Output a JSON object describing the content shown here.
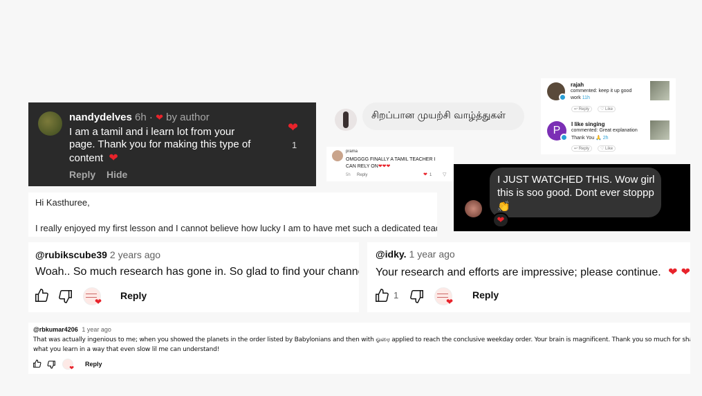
{
  "c1": {
    "username": "nandydelves",
    "time": "6h",
    "by_author": "by author",
    "text_line1": "I am a tamil and i learn lot from your",
    "text_line2": "page. Thank you  for making this type of",
    "text_line3": "content",
    "reply": "Reply",
    "hide": "Hide",
    "like_count": "1"
  },
  "c2": {
    "text": "சிறப்பான முயற்சி வாழ்த்துகள்"
  },
  "c3": {
    "username": "prama",
    "text_line1": "OMGGGG FINALLY A TAMIL TEACHER I",
    "text_line2": "CAN RELY ON",
    "time": "5h",
    "reply": "Reply",
    "like_count": "1"
  },
  "c4": {
    "items": [
      {
        "name": "rajah",
        "line1": "commented: keep it up good",
        "line2": "work",
        "time": "11h",
        "reply": "Reply",
        "like": "Like"
      },
      {
        "name": "I like singing",
        "initial": "P",
        "line1": "commented: Great explanation",
        "line2": "Thank You",
        "time": "2h",
        "reply": "Reply",
        "like": "Like"
      }
    ]
  },
  "c5": {
    "line1": "I JUST WATCHED THIS. Wow girl",
    "line2": "this is soo good. Dont ever stoppp"
  },
  "c6": {
    "greeting": "Hi Kasthuree,",
    "body": "I really enjoyed my first lesson and I cannot believe how lucky I am to have met such a dedicated teacher."
  },
  "c7": {
    "username": "@rubikscube39",
    "time": "2 years ago",
    "text": "Woah.. So much research has gone in. So glad to find your channel!",
    "reply": "Reply"
  },
  "c8": {
    "username": "@idky.",
    "time": "1 year ago",
    "text": "Your research and efforts are impressive; please continue.",
    "like_count": "1",
    "reply": "Reply"
  },
  "c9": {
    "username": "@rbkumar4206",
    "time": "1 year ago",
    "line1": "That was actually ingenious to me; when you showed the planets in the order listed by Babylonians and then with ஓரை applied to reach the conclusive weekday order. Your brain is magnificent. Thank you so much for sharing",
    "line2": "what you learn in a way that even slow lil me can understand!",
    "reply": "Reply"
  },
  "colors": {
    "heart": "#e8232b",
    "dark_card": "#2a2a2a",
    "bubble": "#efefef",
    "accent_blue": "#2a9fd6",
    "avatar_purple": "#7b2fb5"
  },
  "icons": [
    "heart-icon",
    "thumbs-up-icon",
    "thumbs-down-icon",
    "verified-badge-icon",
    "folded-hands-emoji",
    "clapping-hands-emoji"
  ]
}
